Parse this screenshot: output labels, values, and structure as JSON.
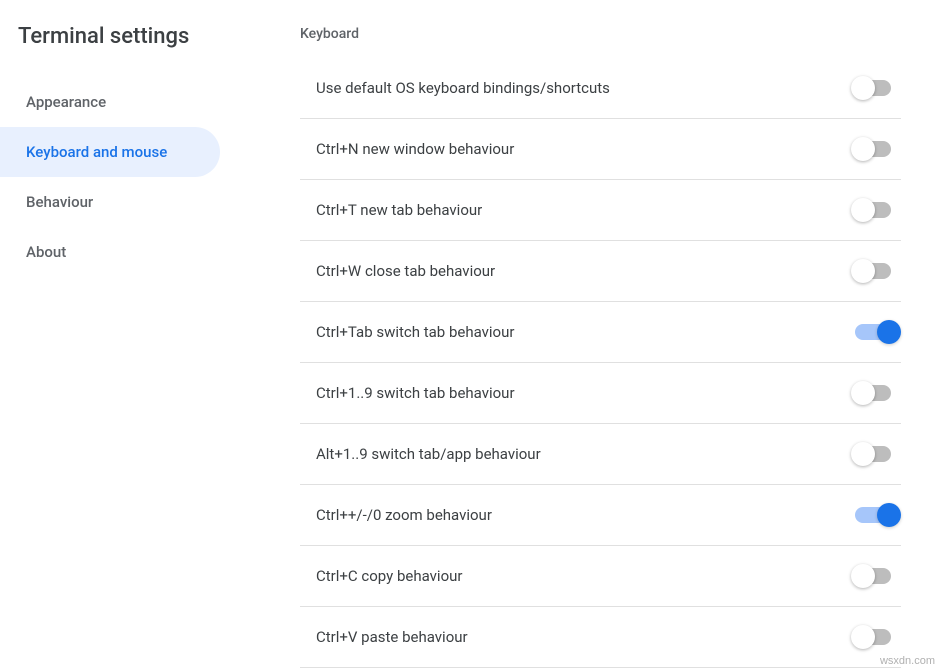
{
  "sidebar": {
    "title": "Terminal settings",
    "items": [
      {
        "label": "Appearance",
        "active": false
      },
      {
        "label": "Keyboard and mouse",
        "active": true
      },
      {
        "label": "Behaviour",
        "active": false
      },
      {
        "label": "About",
        "active": false
      }
    ]
  },
  "main": {
    "section_header": "Keyboard",
    "settings": [
      {
        "label": "Use default OS keyboard bindings/shortcuts",
        "on": false
      },
      {
        "label": "Ctrl+N new window behaviour",
        "on": false
      },
      {
        "label": "Ctrl+T new tab behaviour",
        "on": false
      },
      {
        "label": "Ctrl+W close tab behaviour",
        "on": false
      },
      {
        "label": "Ctrl+Tab switch tab behaviour",
        "on": true
      },
      {
        "label": "Ctrl+1..9 switch tab behaviour",
        "on": false
      },
      {
        "label": "Alt+1..9 switch tab/app behaviour",
        "on": false
      },
      {
        "label": "Ctrl++/-/0 zoom behaviour",
        "on": true
      },
      {
        "label": "Ctrl+C copy behaviour",
        "on": false
      },
      {
        "label": "Ctrl+V paste behaviour",
        "on": false
      }
    ]
  },
  "watermark": "wsxdn.com"
}
